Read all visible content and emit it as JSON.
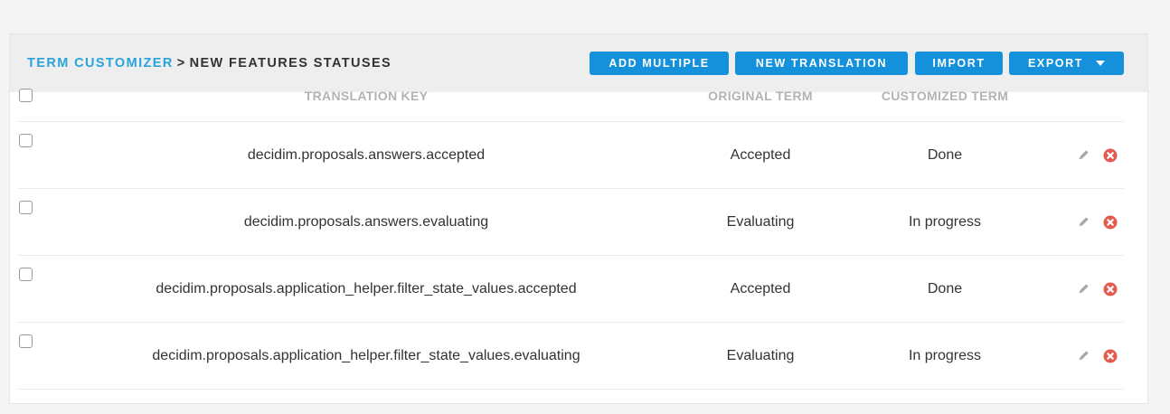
{
  "breadcrumb": {
    "parent": "TERM CUSTOMIZER",
    "separator": ">",
    "current": "NEW FEATURES STATUSES"
  },
  "buttons": {
    "add_multiple": "ADD MULTIPLE",
    "new_translation": "NEW TRANSLATION",
    "import": "IMPORT",
    "export": "EXPORT"
  },
  "table": {
    "headers": {
      "translation_key": "TRANSLATION KEY",
      "original_term": "ORIGINAL TERM",
      "customized_term": "CUSTOMIZED TERM"
    },
    "rows": [
      {
        "key": "decidim.proposals.answers.accepted",
        "original": "Accepted",
        "customized": "Done"
      },
      {
        "key": "decidim.proposals.answers.evaluating",
        "original": "Evaluating",
        "customized": "In progress"
      },
      {
        "key": "decidim.proposals.application_helper.filter_state_values.accepted",
        "original": "Accepted",
        "customized": "Done"
      },
      {
        "key": "decidim.proposals.application_helper.filter_state_values.evaluating",
        "original": "Evaluating",
        "customized": "In progress"
      }
    ]
  },
  "icons": {
    "edit": "pencil-icon",
    "delete": "remove-circle-icon",
    "dropdown": "caret-down-icon"
  },
  "colors": {
    "accent": "#1591db",
    "link": "#2aa3dd",
    "delete": "#e55a4e",
    "edit": "#a8a8a8"
  }
}
